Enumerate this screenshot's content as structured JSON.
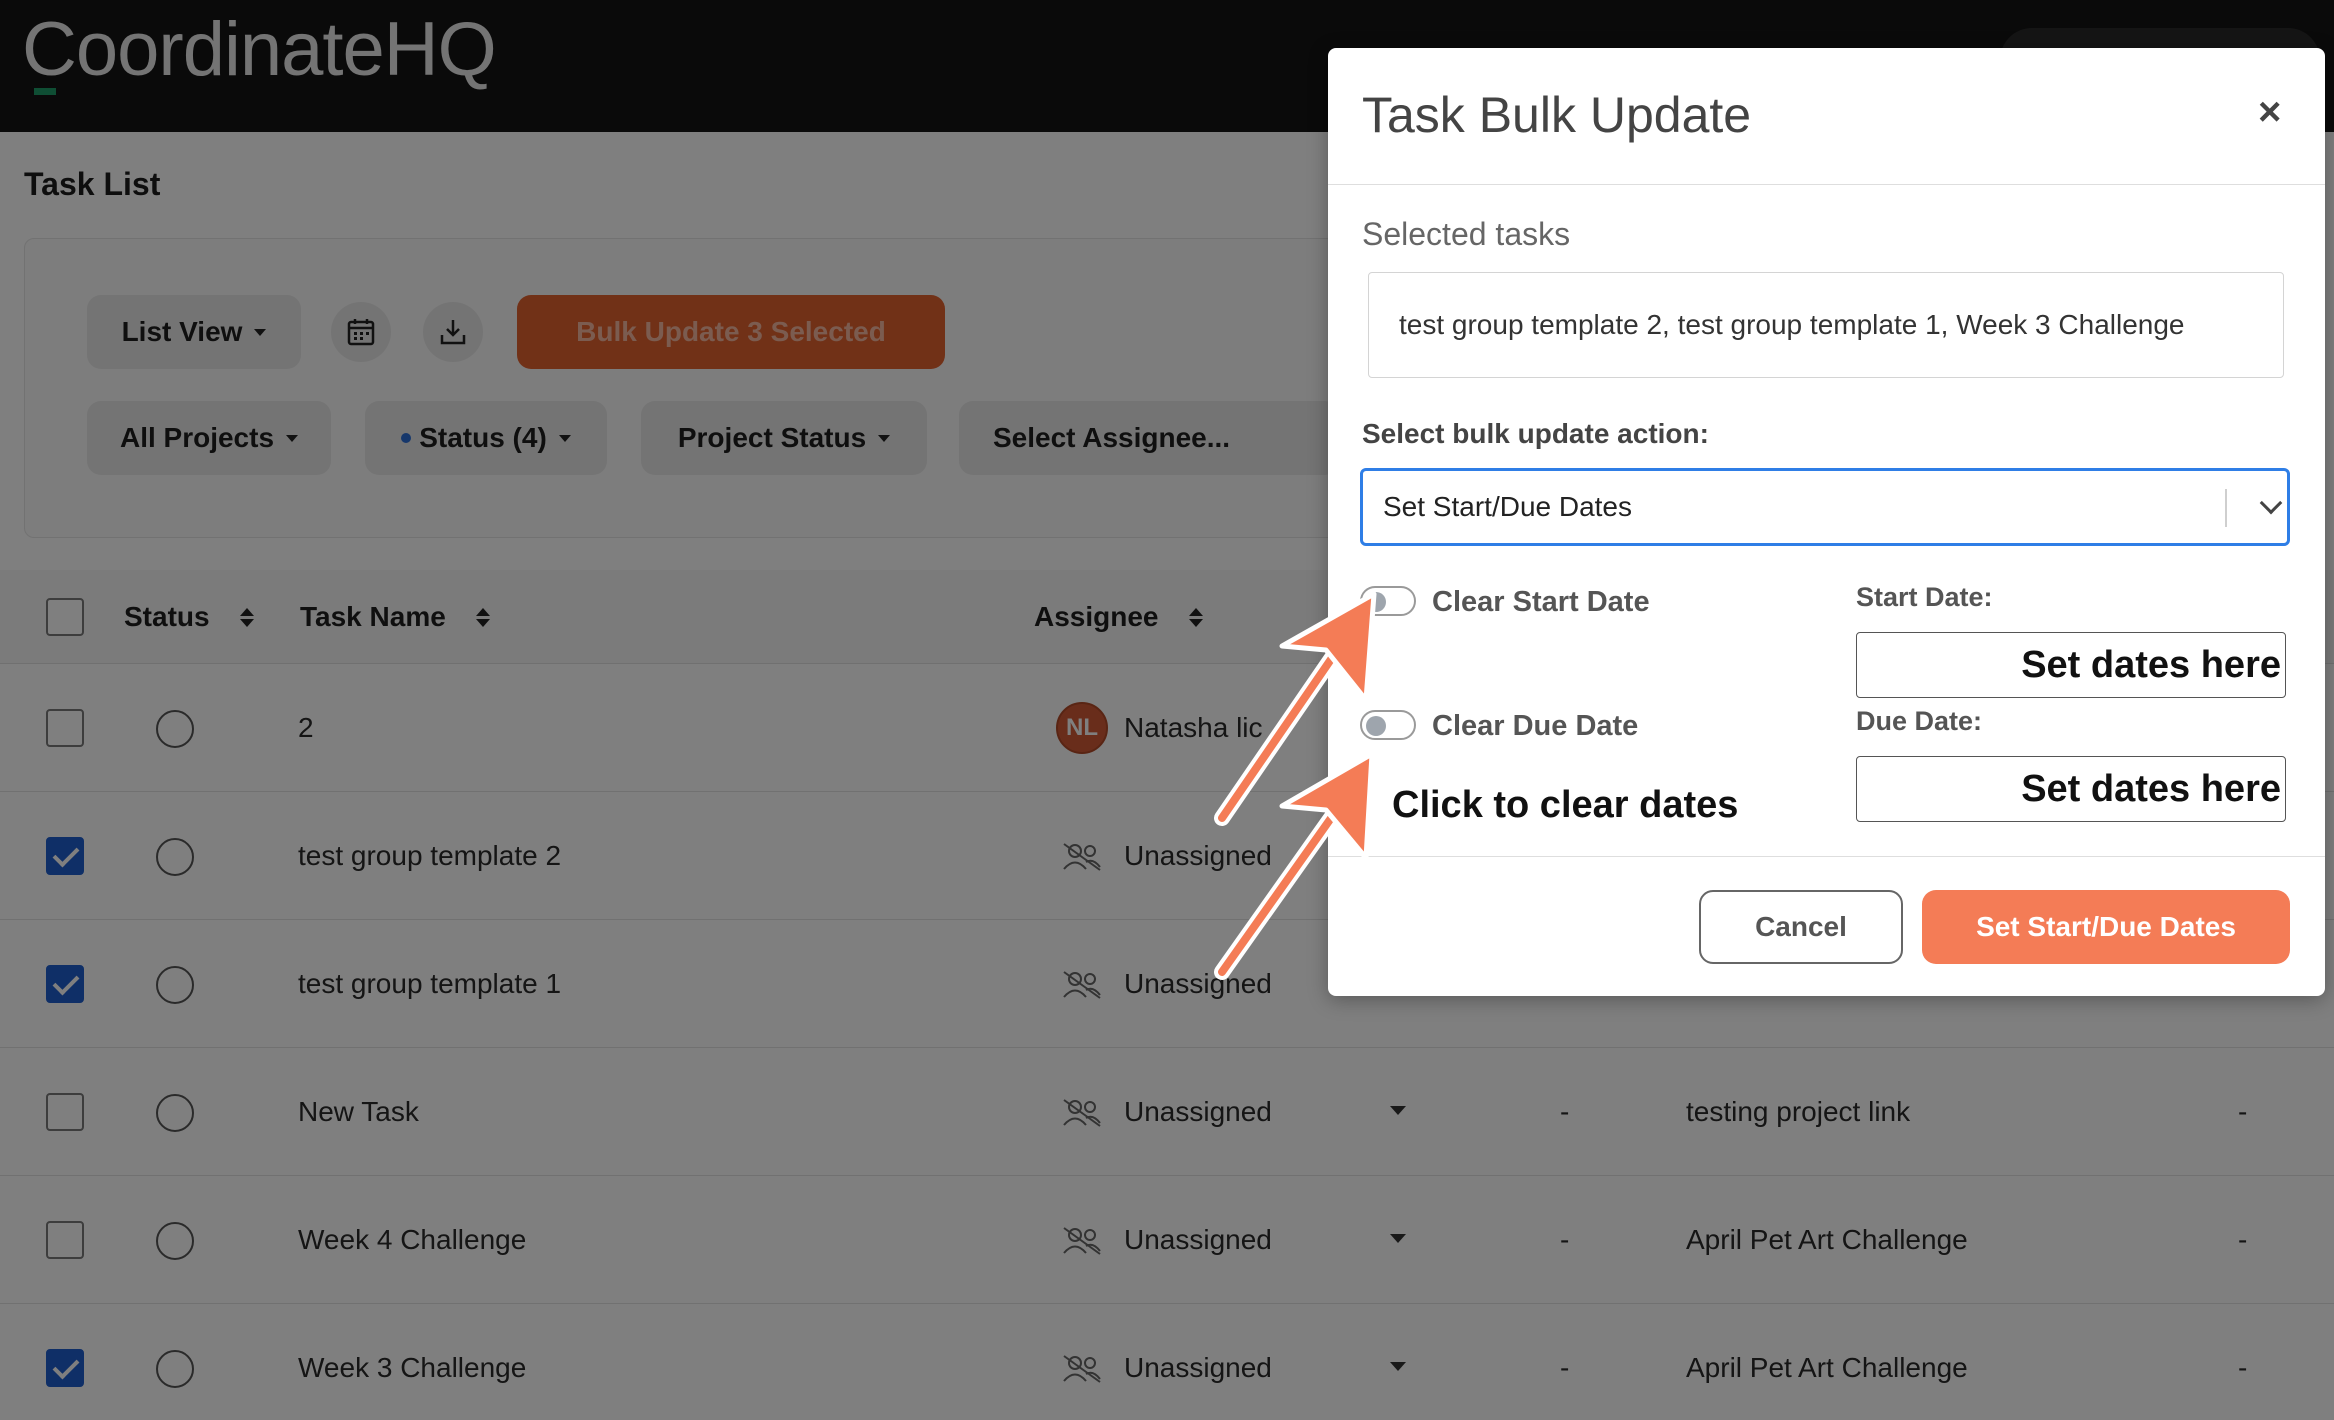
{
  "header": {
    "logo_text": "CoordinateHQ"
  },
  "page": {
    "title": "Task List"
  },
  "toolbar": {
    "list_view_label": "List View",
    "bulk_update_label": "Bulk Update 3 Selected",
    "calendar_icon": "calendar-icon",
    "download_icon": "download-icon"
  },
  "filters": {
    "projects_label": "All Projects",
    "status_label": "Status (4)",
    "project_status_label": "Project Status",
    "assignee_label": "Select Assignee..."
  },
  "table": {
    "columns": [
      "Status",
      "Task Name",
      "Assignee"
    ],
    "rows": [
      {
        "checked": false,
        "task_name": "2",
        "avatar_initials": "NL",
        "assignee": "Natasha lic",
        "project": "",
        "dash": ""
      },
      {
        "checked": true,
        "task_name": "test group template 2",
        "avatar_initials": "",
        "assignee": "Unassigned",
        "project": "",
        "dash": ""
      },
      {
        "checked": true,
        "task_name": "test group template 1",
        "avatar_initials": "",
        "assignee": "Unassigned",
        "project": "",
        "dash": ""
      },
      {
        "checked": false,
        "task_name": "New Task",
        "avatar_initials": "",
        "assignee": "Unassigned",
        "project": "testing project link",
        "dash": "-"
      },
      {
        "checked": false,
        "task_name": "Week 4 Challenge",
        "avatar_initials": "",
        "assignee": "Unassigned",
        "project": "April Pet Art Challenge",
        "dash": "-"
      },
      {
        "checked": true,
        "task_name": "Week 3 Challenge",
        "avatar_initials": "",
        "assignee": "Unassigned",
        "project": "April Pet Art Challenge",
        "dash": "-"
      }
    ]
  },
  "modal": {
    "title": "Task Bulk Update",
    "close_glyph": "×",
    "selected_tasks_label": "Selected tasks",
    "selected_tasks_value": "test group template 2, test group template 1, Week 3 Challenge",
    "action_label": "Select bulk update action:",
    "action_value": "Set Start/Due Dates",
    "clear_start_label": "Clear Start Date",
    "clear_due_label": "Clear Due Date",
    "start_date_label": "Start Date:",
    "due_date_label": "Due Date:",
    "start_date_annotation": "Set dates here",
    "due_date_annotation": "Set dates here",
    "clear_annotation": "Click to clear dates",
    "cancel_label": "Cancel",
    "submit_label": "Set Start/Due Dates"
  },
  "colors": {
    "accent_orange": "#f47c56",
    "checkbox_blue": "#1f5fce",
    "select_focus": "#2f7ee6",
    "annotation_arrow": "#f47c56"
  }
}
